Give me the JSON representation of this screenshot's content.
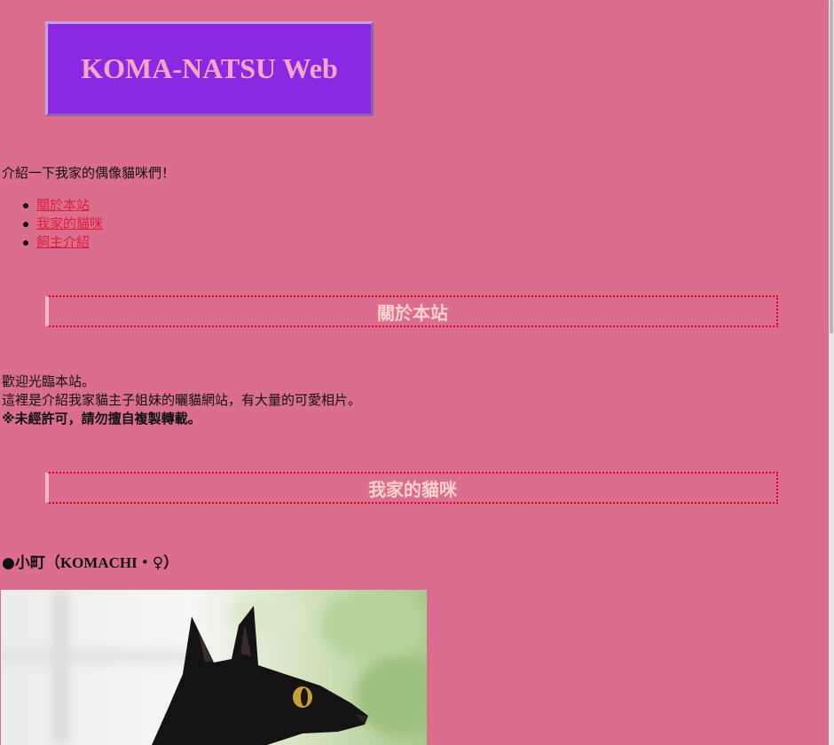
{
  "site": {
    "title": "KOMA-NATSU Web"
  },
  "intro": "介紹一下我家的偶像貓咪們！",
  "nav": {
    "items": [
      {
        "label": "關於本站"
      },
      {
        "label": "我家的貓咪"
      },
      {
        "label": "飼主介紹"
      }
    ]
  },
  "sections": {
    "about": {
      "heading": "關於本站",
      "line1": "歡迎光臨本站。",
      "line2": "這裡是介紹我家貓主子姐妹的曬貓網站，有大量的可愛相片。",
      "line3": "※未經許可，請勿擅自複製轉載。"
    },
    "cats": {
      "heading": "我家的貓咪",
      "cat1": {
        "prefix": "●小町（",
        "name_en": "KOMACHI",
        "suffix": "・♀）"
      }
    }
  },
  "colors": {
    "background": "#db6e8e",
    "title_box": "#8a28e2",
    "title_text": "#f3a6c7",
    "link": "#dc1e3c",
    "section_heading_text": "#fbd2cc",
    "section_border": "#e8001c"
  },
  "icons": {
    "list_bullet": "disc-bullet-icon"
  }
}
